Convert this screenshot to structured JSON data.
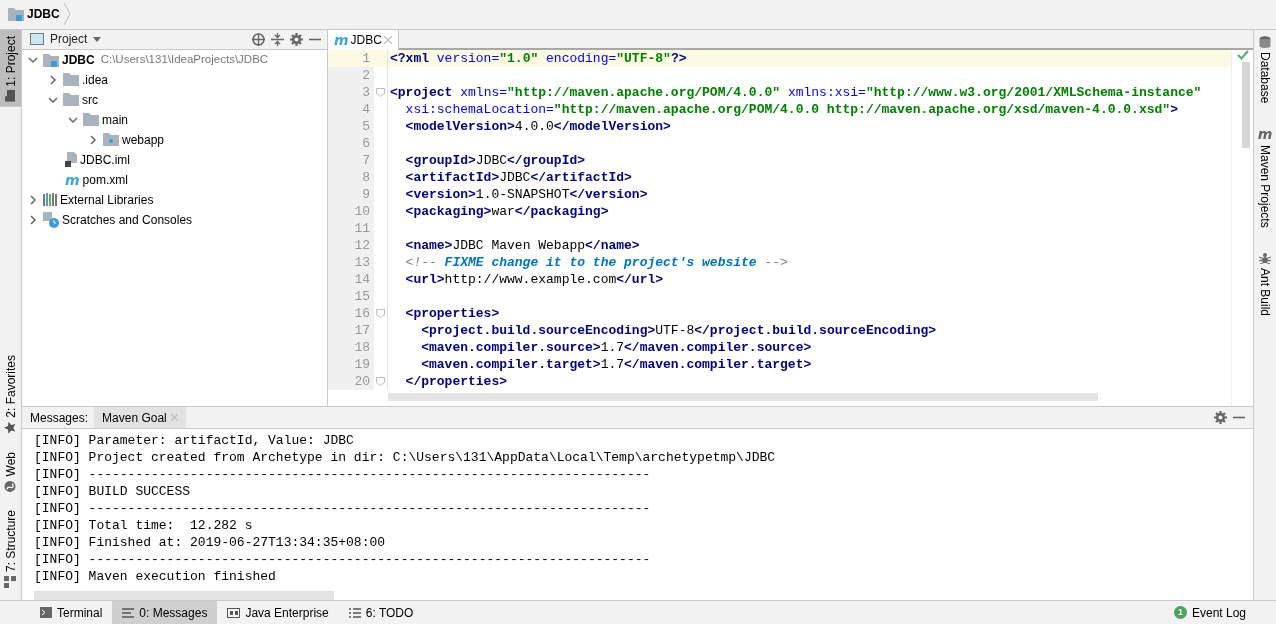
{
  "breadcrumb": {
    "label": "JDBC"
  },
  "left_strip": {
    "top": [
      {
        "label": "1: Project",
        "kind": "project",
        "selected": true
      }
    ],
    "bottom": [
      {
        "label": "2: Favorites",
        "kind": "favorites",
        "selected": false
      },
      {
        "label": "Web",
        "kind": "web",
        "selected": false
      },
      {
        "label": "7: Structure",
        "kind": "structure",
        "selected": false
      }
    ]
  },
  "project_panel": {
    "title": "Project",
    "tree": [
      {
        "label": "JDBC",
        "path": "C:\\Users\\131\\IdeaProjects\\JDBC",
        "kind": "module",
        "expanded": true,
        "children": [
          {
            "label": ".idea",
            "kind": "folder",
            "expanded": false
          },
          {
            "label": "src",
            "kind": "folder",
            "expanded": true,
            "children": [
              {
                "label": "main",
                "kind": "folder",
                "expanded": true,
                "children": [
                  {
                    "label": "webapp",
                    "kind": "webfolder",
                    "expanded": false
                  }
                ]
              }
            ]
          },
          {
            "label": "JDBC.iml",
            "kind": "file"
          },
          {
            "label": "pom.xml",
            "kind": "maven",
            "glyph": "m"
          }
        ]
      },
      {
        "label": "External Libraries",
        "kind": "libraries",
        "expanded": false
      },
      {
        "label": "Scratches and Consoles",
        "kind": "scratches",
        "expanded": false
      }
    ]
  },
  "editor": {
    "tabs": [
      {
        "label": "JDBC",
        "glyph": "m",
        "selected": true
      }
    ],
    "lines": [
      {
        "number": "1",
        "current": true,
        "tokens": [
          {
            "kind": "tag",
            "text": "<?xml"
          },
          {
            "kind": "attr",
            "text": " version="
          },
          {
            "kind": "value",
            "text": "\"1.0\""
          },
          {
            "kind": "attr",
            "text": " encoding="
          },
          {
            "kind": "value",
            "text": "\"UTF-8\""
          },
          {
            "kind": "tag",
            "text": "?>"
          }
        ]
      },
      {
        "number": "2",
        "current": false
      },
      {
        "number": "3",
        "current": false,
        "fold": true,
        "tokens": [
          {
            "kind": "tag",
            "text": "<project"
          },
          {
            "kind": "attr",
            "text": " xmlns="
          },
          {
            "kind": "value",
            "text": "\"http://maven.apache.org/POM/4.0.0\""
          },
          {
            "kind": "attr",
            "text": " xmlns:xsi="
          },
          {
            "kind": "value",
            "text": "\"http://www.w3.org/2001/XMLSchema-instance\""
          }
        ]
      },
      {
        "number": "4",
        "current": false,
        "tokens": [
          {
            "kind": "attr",
            "text": "  xsi:schemaLocation="
          },
          {
            "kind": "value",
            "text": "\"http://maven.apache.org/POM/4.0.0 http://maven.apache.org/xsd/maven-4.0.0.xsd\""
          },
          {
            "kind": "tag",
            "text": ">"
          }
        ]
      },
      {
        "number": "5",
        "current": false,
        "tokens": [
          {
            "kind": "tag",
            "text": "  <modelVersion>"
          },
          {
            "kind": "text",
            "text": "4.0.0"
          },
          {
            "kind": "tag",
            "text": "</modelVersion>"
          }
        ]
      },
      {
        "number": "6",
        "current": false
      },
      {
        "number": "7",
        "current": false,
        "tokens": [
          {
            "kind": "tag",
            "text": "  <groupId>"
          },
          {
            "kind": "text",
            "text": "JDBC"
          },
          {
            "kind": "tag",
            "text": "</groupId>"
          }
        ]
      },
      {
        "number": "8",
        "current": false,
        "tokens": [
          {
            "kind": "tag",
            "text": "  <artifactId>"
          },
          {
            "kind": "text",
            "text": "JDBC"
          },
          {
            "kind": "tag",
            "text": "</artifactId>"
          }
        ]
      },
      {
        "number": "9",
        "current": false,
        "tokens": [
          {
            "kind": "tag",
            "text": "  <version>"
          },
          {
            "kind": "text",
            "text": "1.0-SNAPSHOT"
          },
          {
            "kind": "tag",
            "text": "</version>"
          }
        ]
      },
      {
        "number": "10",
        "current": false,
        "tokens": [
          {
            "kind": "tag",
            "text": "  <packaging>"
          },
          {
            "kind": "text",
            "text": "war"
          },
          {
            "kind": "tag",
            "text": "</packaging>"
          }
        ]
      },
      {
        "number": "11",
        "current": false
      },
      {
        "number": "12",
        "current": false,
        "tokens": [
          {
            "kind": "tag",
            "text": "  <name>"
          },
          {
            "kind": "text",
            "text": "JDBC Maven Webapp"
          },
          {
            "kind": "tag",
            "text": "</name>"
          }
        ]
      },
      {
        "number": "13",
        "current": false,
        "tokens": [
          {
            "kind": "comment",
            "text": "  <!-- "
          },
          {
            "kind": "todo",
            "text": "FIXME change it to the project's website"
          },
          {
            "kind": "comment",
            "text": " -->"
          }
        ]
      },
      {
        "number": "14",
        "current": false,
        "tokens": [
          {
            "kind": "tag",
            "text": "  <url>"
          },
          {
            "kind": "text",
            "text": "http://www.example.com"
          },
          {
            "kind": "tag",
            "text": "</url>"
          }
        ]
      },
      {
        "number": "15",
        "current": false
      },
      {
        "number": "16",
        "current": false,
        "fold": true,
        "tokens": [
          {
            "kind": "tag",
            "text": "  <properties>"
          }
        ]
      },
      {
        "number": "17",
        "current": false,
        "tokens": [
          {
            "kind": "tag",
            "text": "    <project.build.sourceEncoding>"
          },
          {
            "kind": "text",
            "text": "UTF-8"
          },
          {
            "kind": "tag",
            "text": "</project.build.sourceEncoding>"
          }
        ]
      },
      {
        "number": "18",
        "current": false,
        "tokens": [
          {
            "kind": "tag",
            "text": "    <maven.compiler.source>"
          },
          {
            "kind": "text",
            "text": "1.7"
          },
          {
            "kind": "tag",
            "text": "</maven.compiler.source>"
          }
        ]
      },
      {
        "number": "19",
        "current": false,
        "tokens": [
          {
            "kind": "tag",
            "text": "    <maven.compiler.target>"
          },
          {
            "kind": "text",
            "text": "1.7"
          },
          {
            "kind": "tag",
            "text": "</maven.compiler.target>"
          }
        ]
      },
      {
        "number": "20",
        "current": false,
        "fold": true,
        "tokens": [
          {
            "kind": "tag",
            "text": "  </properties>"
          }
        ]
      }
    ]
  },
  "right_strip": [
    {
      "label": "Database",
      "kind": "database"
    },
    {
      "label": "Maven Projects",
      "kind": "maven",
      "glyph": "m"
    },
    {
      "label": "Ant Build",
      "kind": "ant"
    }
  ],
  "messages_panel": {
    "label": "Messages:",
    "tabs": [
      {
        "label": "Maven Goal",
        "selected": true
      }
    ],
    "lines": [
      "[INFO] Parameter: artifactId, Value: JDBC",
      "[INFO] Project created from Archetype in dir: C:\\Users\\131\\AppData\\Local\\Temp\\archetypetmp\\JDBC",
      "[INFO] ------------------------------------------------------------------------",
      "[INFO] BUILD SUCCESS",
      "[INFO] ------------------------------------------------------------------------",
      "[INFO] Total time:  12.282 s",
      "[INFO] Finished at: 2019-06-27T13:34:35+08:00",
      "[INFO] ------------------------------------------------------------------------",
      "[INFO] Maven execution finished"
    ]
  },
  "bottom_tabs": [
    {
      "label": "Terminal",
      "kind": "terminal",
      "selected": false
    },
    {
      "label": "0: Messages",
      "kind": "messages",
      "selected": true
    },
    {
      "label": "Java Enterprise",
      "kind": "javaee",
      "selected": false
    },
    {
      "label": "6: TODO",
      "kind": "todo",
      "selected": false
    }
  ],
  "event_log": {
    "label": "Event Log",
    "badge": "1"
  }
}
